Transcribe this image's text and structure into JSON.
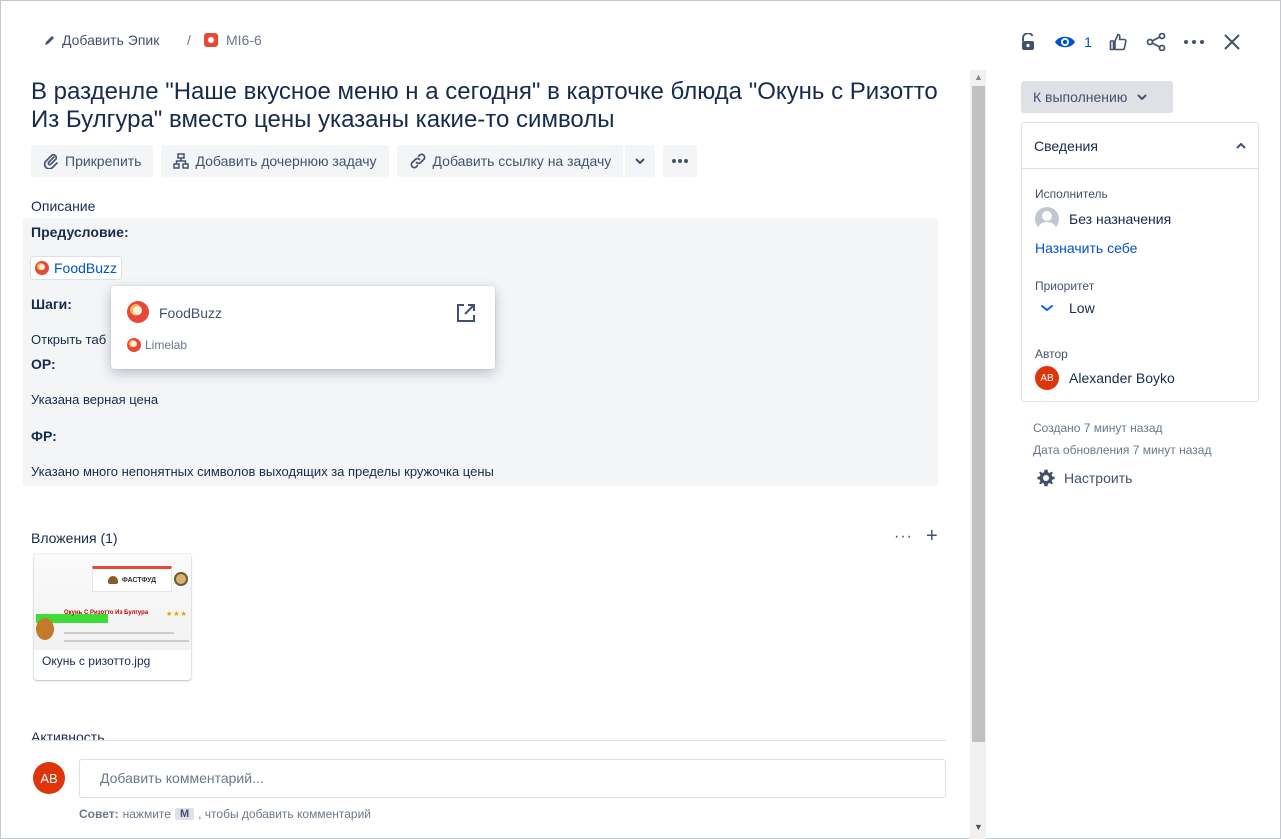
{
  "header": {
    "add_epic": "Добавить Эпик",
    "separator": "/",
    "issue_key": "MI6-6",
    "watch_count": "1",
    "icons": [
      "lock-icon",
      "eye-icon",
      "like-icon",
      "share-icon",
      "more-icon",
      "close-icon"
    ]
  },
  "title": "В разденле \"Наше вкусное меню н а сегодня\" в карточке блюда \"Окунь с Ризотто Из Булгура\" вместо цены указаны какие-то символы",
  "actions": {
    "attach": "Прикрепить",
    "add_child": "Добавить дочернюю задачу",
    "add_link": "Добавить ссылку на задачу"
  },
  "description": {
    "label": "Описание",
    "precondition": "Предусловие:",
    "chip": "FoodBuzz",
    "steps": "Шаги:",
    "steps_text": "Открыть таб",
    "expected_label": "ОР:",
    "expected_text": "Указана верная цена",
    "actual_label": "ФР:",
    "actual_text": "Указано много непонятных символов выходящих за пределы кружочка цены"
  },
  "popup": {
    "title": "FoodBuzz",
    "subtitle": "Limelab"
  },
  "attachments": {
    "label": "Вложения (1)",
    "file_name": "Окунь с ризотто.jpg",
    "thumb_brand": "ФАСТФУД",
    "thumb_dish": "Окунь С Ризотто Из Булгура",
    "thumb_stars": "★★★"
  },
  "activity": {
    "label": "Активность",
    "avatar": "AB",
    "placeholder": "Добавить комментарий...",
    "tip_prefix": "Совет:",
    "tip_mid": "нажмите",
    "tip_key": "M",
    "tip_suffix": ", чтобы добавить комментарий"
  },
  "sidebar": {
    "status": "К выполнению",
    "details_title": "Сведения",
    "assignee_label": "Исполнитель",
    "assignee_value": "Без назначения",
    "assign_to_me": "Назначить себе",
    "priority_label": "Приоритет",
    "priority_value": "Low",
    "reporter_label": "Автор",
    "reporter_avatar": "AB",
    "reporter_name": "Alexander Boyko",
    "created": "Создано 7 минут назад",
    "updated": "Дата обновления 7 минут назад",
    "configure": "Настроить"
  },
  "colors": {
    "accent": "#0052cc",
    "avatar": "#de350b",
    "bug": "#e5493a"
  }
}
